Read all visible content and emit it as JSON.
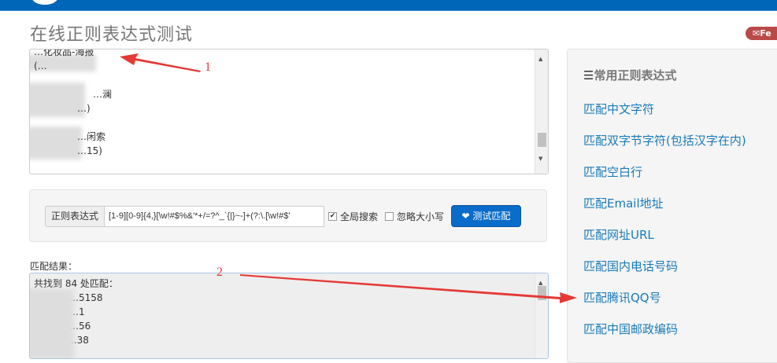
{
  "header": {
    "title": "在线正则表达式测试",
    "feedback_label": "Fe"
  },
  "input_text": {
    "lines": [
      "…化妆品-海报",
      "(…",
      "…澜",
      "…)",
      "…闲索",
      "…15)"
    ]
  },
  "form": {
    "addon_label": "正则表达式",
    "regex_value": "[1-9][0-9]{4,}[\\w!#$%&'*+/=?^_`{|}~-]+(?:\\.[\\w!#$'",
    "global_label": "全局搜索",
    "global_checked": true,
    "ignorecase_label": "忽略大小写",
    "ignorecase_checked": false,
    "test_button": "测试匹配"
  },
  "result": {
    "label": "匹配结果：",
    "summary": "共找到 84 处匹配：",
    "lines": [
      "…5158",
      "…1",
      "…56",
      "7…38"
    ]
  },
  "sidebar": {
    "heading": "常用正则表达式",
    "items": [
      "匹配中文字符",
      "匹配双字节字符(包括汉字在内)",
      "匹配空白行",
      "匹配Email地址",
      "匹配网址URL",
      "匹配国内电话号码",
      "匹配腾讯QQ号",
      "匹配中国邮政编码"
    ]
  },
  "annotations": [
    "1",
    "2"
  ],
  "colors": {
    "brand": "#0067b8",
    "link": "#1a7bb9",
    "annotation": "#e53935"
  }
}
